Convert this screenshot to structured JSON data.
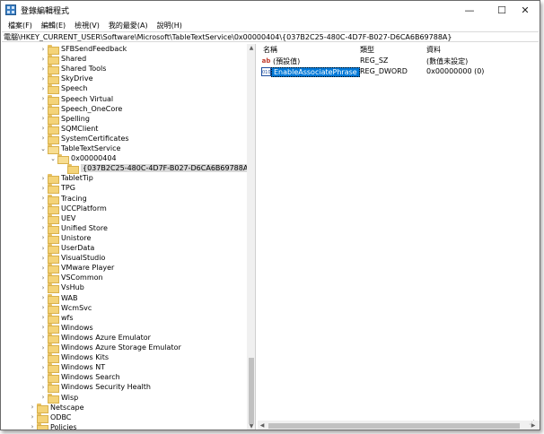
{
  "window": {
    "title": "登錄編輯程式",
    "controls": {
      "minimize": "—",
      "maximize": "☐",
      "close": "✕"
    }
  },
  "menu": [
    "檔案(F)",
    "編輯(E)",
    "檢視(V)",
    "我的最愛(A)",
    "說明(H)"
  ],
  "address": "電腦\\HKEY_CURRENT_USER\\Software\\Microsoft\\TableTextService\\0x00000404\\{037B2C25-480C-4D7F-B027-D6CA6B69788A}",
  "tree": [
    {
      "label": "SFBSendFeedback",
      "level": 2,
      "state": "collapsed"
    },
    {
      "label": "Shared",
      "level": 2,
      "state": "collapsed"
    },
    {
      "label": "Shared Tools",
      "level": 2,
      "state": "collapsed"
    },
    {
      "label": "SkyDrive",
      "level": 2,
      "state": "collapsed"
    },
    {
      "label": "Speech",
      "level": 2,
      "state": "collapsed"
    },
    {
      "label": "Speech Virtual",
      "level": 2,
      "state": "collapsed"
    },
    {
      "label": "Speech_OneCore",
      "level": 2,
      "state": "collapsed"
    },
    {
      "label": "Spelling",
      "level": 2,
      "state": "collapsed"
    },
    {
      "label": "SQMClient",
      "level": 2,
      "state": "collapsed"
    },
    {
      "label": "SystemCertificates",
      "level": 2,
      "state": "collapsed"
    },
    {
      "label": "TableTextService",
      "level": 2,
      "state": "expanded"
    },
    {
      "label": "0x00000404",
      "level": 3,
      "state": "expanded"
    },
    {
      "label": "{037B2C25-480C-4D7F-B027-D6CA6B69788A}",
      "level": 4,
      "state": "leaf",
      "selected": true
    },
    {
      "label": "TabletTip",
      "level": 2,
      "state": "collapsed"
    },
    {
      "label": "TPG",
      "level": 2,
      "state": "collapsed"
    },
    {
      "label": "Tracing",
      "level": 2,
      "state": "collapsed"
    },
    {
      "label": "UCCPlatform",
      "level": 2,
      "state": "collapsed"
    },
    {
      "label": "UEV",
      "level": 2,
      "state": "collapsed"
    },
    {
      "label": "Unified Store",
      "level": 2,
      "state": "collapsed"
    },
    {
      "label": "Unistore",
      "level": 2,
      "state": "collapsed"
    },
    {
      "label": "UserData",
      "level": 2,
      "state": "collapsed"
    },
    {
      "label": "VisualStudio",
      "level": 2,
      "state": "collapsed"
    },
    {
      "label": "VMware Player",
      "level": 2,
      "state": "collapsed"
    },
    {
      "label": "VSCommon",
      "level": 2,
      "state": "collapsed"
    },
    {
      "label": "VsHub",
      "level": 2,
      "state": "collapsed"
    },
    {
      "label": "WAB",
      "level": 2,
      "state": "collapsed"
    },
    {
      "label": "WcmSvc",
      "level": 2,
      "state": "collapsed"
    },
    {
      "label": "wfs",
      "level": 2,
      "state": "collapsed"
    },
    {
      "label": "Windows",
      "level": 2,
      "state": "collapsed"
    },
    {
      "label": "Windows Azure Emulator",
      "level": 2,
      "state": "collapsed"
    },
    {
      "label": "Windows Azure Storage Emulator",
      "level": 2,
      "state": "collapsed"
    },
    {
      "label": "Windows Kits",
      "level": 2,
      "state": "collapsed"
    },
    {
      "label": "Windows NT",
      "level": 2,
      "state": "collapsed"
    },
    {
      "label": "Windows Search",
      "level": 2,
      "state": "collapsed"
    },
    {
      "label": "Windows Security Health",
      "level": 2,
      "state": "collapsed"
    },
    {
      "label": "Wisp",
      "level": 2,
      "state": "collapsed"
    },
    {
      "label": "Netscape",
      "level": 1,
      "state": "collapsed"
    },
    {
      "label": "ODBC",
      "level": 1,
      "state": "collapsed"
    },
    {
      "label": "Policies",
      "level": 1,
      "state": "collapsed"
    }
  ],
  "list": {
    "columns": [
      "名稱",
      "類型",
      "資料"
    ],
    "rows": [
      {
        "icon": "string-value-icon",
        "name": "(預設值)",
        "type": "REG_SZ",
        "data": "(數值未設定)",
        "selected": false
      },
      {
        "icon": "dword-value-icon",
        "name": "EnableAssociatePhrase",
        "type": "REG_DWORD",
        "data": "0x00000000 (0)",
        "selected": true
      }
    ]
  }
}
